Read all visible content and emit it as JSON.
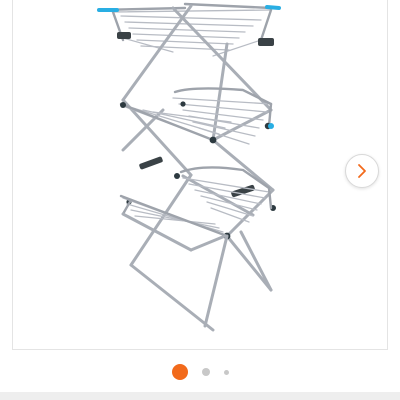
{
  "gallery": {
    "image_alt": "",
    "current_slide": 1,
    "total_slides": 3,
    "next_icon": "chevron-right-icon"
  },
  "colors": {
    "accent": "#f26a1b",
    "dot_inactive": "#c8c8c8",
    "frame_metal": "#b8bcc4",
    "frame_metal_dark": "#8e939c",
    "tip_blue": "#29aee3",
    "joint_dark": "#2d3a40",
    "arrow": "#f26a1b"
  }
}
